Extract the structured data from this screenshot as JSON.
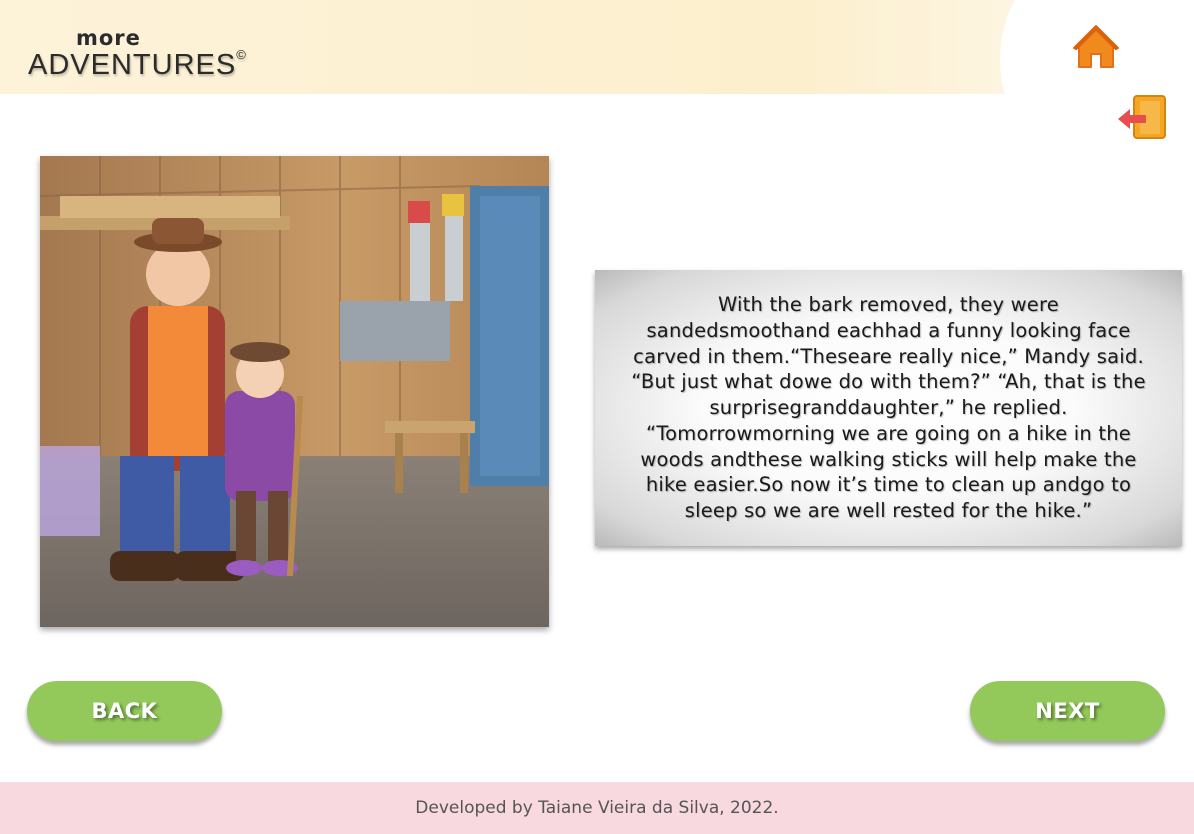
{
  "brand": {
    "logo_top": "more",
    "logo_main": "ADVENTURES",
    "logo_mark": "©"
  },
  "header": {
    "home_icon": "home-icon",
    "exit_icon": "exit-door-icon"
  },
  "story": {
    "illustration": "grandfather-and-granddaughter-in-woodshop-illustration",
    "text": "With the bark removed, they were sandedsmoothand eachhad a funny looking face carved in them.“Theseare really nice,” Mandy said. “But just what dowe do with them?” “Ah, that is the surprisegranddaughter,” he replied. “Tomorrowmorning we are going on a hike in the woods andthese walking sticks will help make the hike easier.So now it’s time to clean up andgo to sleep so we are well rested for the hike.”"
  },
  "nav": {
    "back_label": "BACK",
    "next_label": "NEXT"
  },
  "footer": {
    "credit": "Developed by Taiane Vieira da Silva, 2022."
  },
  "colors": {
    "header_bg": "#fdf3d9",
    "button_green": "#93c95a",
    "footer_bg": "#f7d9df",
    "home_orange": "#f08a1c",
    "exit_red": "#e84e4e"
  }
}
